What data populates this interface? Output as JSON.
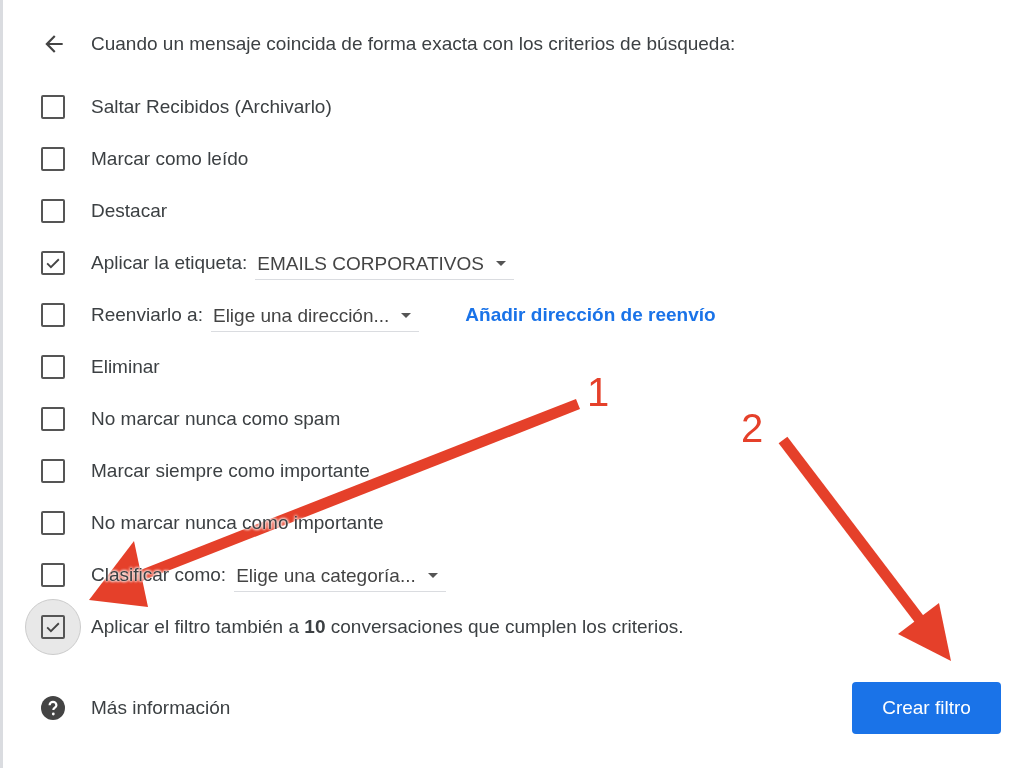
{
  "header": {
    "title": "Cuando un mensaje coincida de forma exacta con los criterios de búsqueda:"
  },
  "rows": [
    {
      "kind": "plain",
      "label": "Saltar Recibidos (Archivarlo)",
      "checked": false,
      "focused": false
    },
    {
      "kind": "plain",
      "label": "Marcar como leído",
      "checked": false,
      "focused": false
    },
    {
      "kind": "plain",
      "label": "Destacar",
      "checked": false,
      "focused": false
    },
    {
      "kind": "select",
      "label": "Aplicar la etiqueta:",
      "select": "EMAILS CORPORATIVOS",
      "checked": true,
      "focused": false
    },
    {
      "kind": "select",
      "label": "Reenviarlo a:",
      "select": "Elige una dirección...",
      "link": "Añadir dirección de reenvío",
      "checked": false,
      "focused": false
    },
    {
      "kind": "plain",
      "label": "Eliminar",
      "checked": false,
      "focused": false
    },
    {
      "kind": "plain",
      "label": "No marcar nunca como spam",
      "checked": false,
      "focused": false
    },
    {
      "kind": "plain",
      "label": "Marcar siempre como importante",
      "checked": false,
      "focused": false
    },
    {
      "kind": "plain",
      "label": "No marcar nunca como importante",
      "checked": false,
      "focused": false
    },
    {
      "kind": "select",
      "label": "Clasificar como:",
      "select": "Elige una categoría...",
      "checked": false,
      "focused": false
    },
    {
      "kind": "plain",
      "label": "Aplicar el filtro también a **10** conversaciones que cumplen los criterios.",
      "checked": true,
      "focused": true
    }
  ],
  "footer": {
    "help": "Más información",
    "button": "Crear filtro"
  },
  "annotations": [
    {
      "number": "1"
    },
    {
      "number": "2"
    }
  ]
}
